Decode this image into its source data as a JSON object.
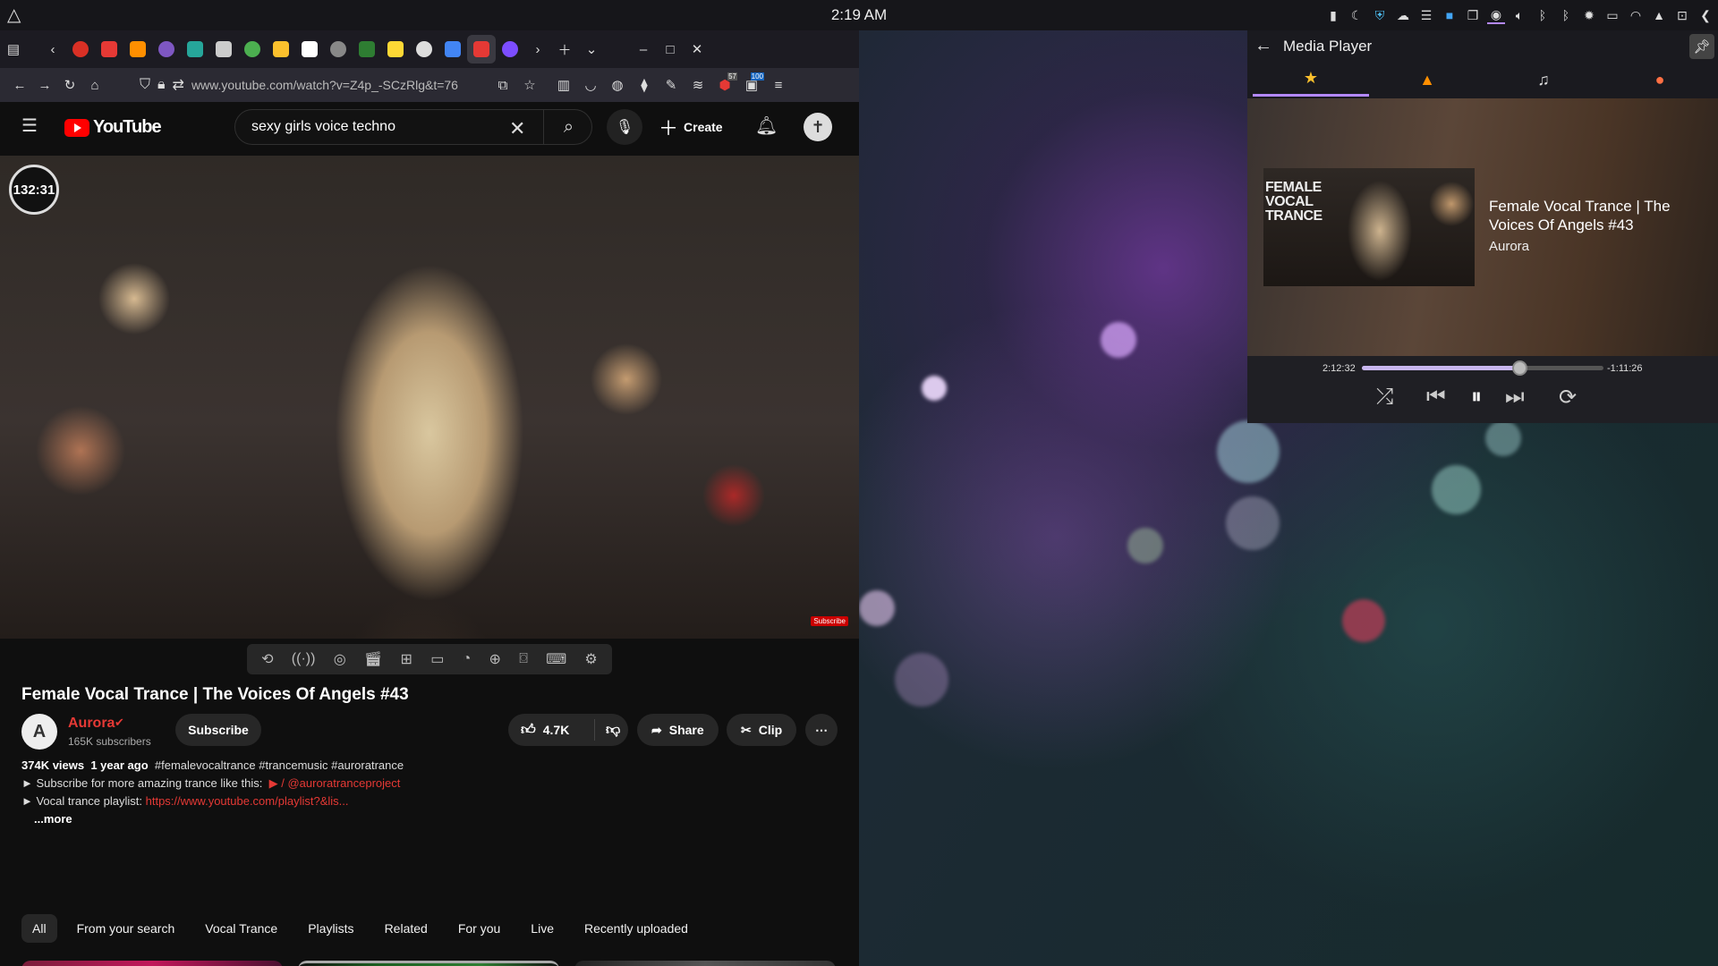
{
  "panel": {
    "clock": "2:19 AM"
  },
  "browser": {
    "url": "www.youtube.com/watch?v=Z4p_-SCzRlg&t=76",
    "tab_colors": [
      "#d93025",
      "#e53935",
      "#ff8f00",
      "#7e57c2",
      "#26a69a",
      "#cccccc",
      "#4caf50",
      "#fbc02d",
      "#ffffff",
      "#888888",
      "#2e7d32",
      "#fdd835",
      "#dddddd",
      "#4285f4",
      "#e53935",
      "#7c4dff"
    ],
    "nav_badge_1": "57",
    "nav_badge_2": "100"
  },
  "youtube": {
    "logo_text": "YouTube",
    "search_value": "sexy girls voice techno",
    "create_label": "Create",
    "video_timer": "132:31",
    "subscribe_watermark": "Subscribe",
    "video_title": "Female Vocal Trance | The Voices Of Angels #43",
    "channel_name": "Aurora",
    "channel_subs": "165K subscribers",
    "subscribe_label": "Subscribe",
    "like_count": "4.7K",
    "share_label": "Share",
    "clip_label": "Clip",
    "description": {
      "views": "374K views",
      "age": "1 year ago",
      "hashtags": "#femalevocaltrance #trancemusic #auroratrance",
      "line1_prefix": "► Subscribe for more amazing trance like this:",
      "line1_link": "/ @auroratranceproject",
      "line2_prefix": "► Vocal trance playlist:",
      "line2_link": "https://www.youtube.com/playlist?&lis...",
      "more": "...more"
    },
    "chips": [
      "All",
      "From your search",
      "Vocal Trance",
      "Playlists",
      "Related",
      "For you",
      "Live",
      "Recently uploaded"
    ]
  },
  "media_player": {
    "title": "Media Player",
    "art_text": "FEMALE VOCAL TRANCE",
    "track_title": "Female Vocal Trance | The Voices Of Angels #43",
    "track_artist": "Aurora",
    "elapsed": "2:12:32",
    "remaining": "-1:11:26",
    "progress_fraction": 0.65,
    "accent": "#b388ff"
  }
}
